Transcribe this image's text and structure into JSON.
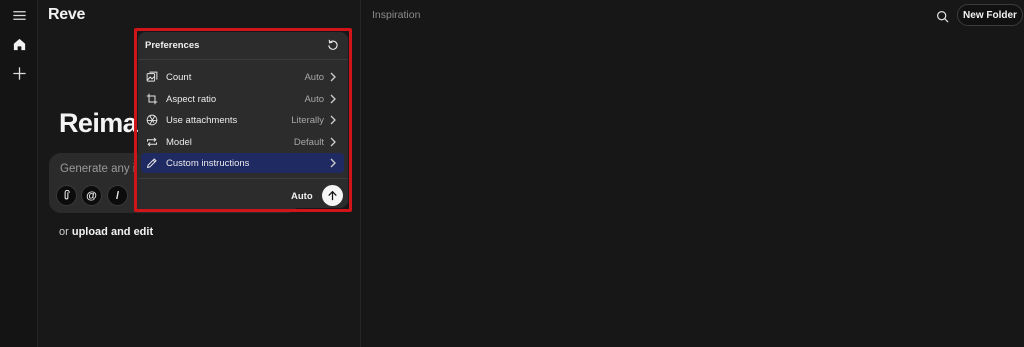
{
  "app": {
    "brand": "Reve"
  },
  "rail": {
    "items": [
      {
        "icon": "menu-icon"
      },
      {
        "icon": "home-icon"
      },
      {
        "icon": "plus-icon"
      }
    ]
  },
  "left_panel": {
    "hero_text": "Reimag",
    "prompt_placeholder": "Generate any i",
    "tools": [
      {
        "icon": "attachment-icon"
      },
      {
        "icon": "mention-icon",
        "glyph": "@"
      },
      {
        "icon": "slash-command-icon",
        "glyph": "/"
      }
    ],
    "upload_prefix": "or",
    "upload_link": "upload and edit"
  },
  "right_area": {
    "title": "Inspiration",
    "new_folder_label": "New Folder"
  },
  "preferences": {
    "title": "Preferences",
    "rows": [
      {
        "label": "Count",
        "value": "Auto",
        "icon": "count-icon",
        "active": false
      },
      {
        "label": "Aspect ratio",
        "value": "Auto",
        "icon": "crop-icon",
        "active": false
      },
      {
        "label": "Use attachments",
        "value": "Literally",
        "icon": "aperture-icon",
        "active": false
      },
      {
        "label": "Model",
        "value": "Default",
        "icon": "repeat-icon",
        "active": false
      },
      {
        "label": "Custom instructions",
        "value": "",
        "icon": "pencil-icon",
        "active": true
      }
    ],
    "footer_label": "Auto"
  },
  "colors": {
    "background": "#171717",
    "panel": "#2c2c2c",
    "active_row": "#1f2a63",
    "highlight_border": "#d0141a"
  }
}
